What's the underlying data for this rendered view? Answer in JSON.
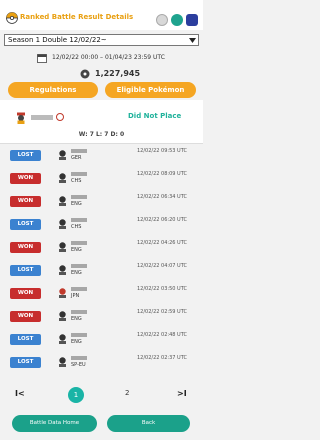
{
  "header": {
    "title": "Ranked Battle Result Details"
  },
  "season_select": {
    "selected": "Season 1 Double 12/02/22~"
  },
  "date_range": "12/02/22 00:00 – 01/04/23 23:59 UTC",
  "score": "1,227,945",
  "buttons": {
    "regulations": "Regulations",
    "eligible": "Eligible Pokémon"
  },
  "player": {
    "placement": "Did Not Place",
    "record": "W: 7 L: 7 D: 0"
  },
  "battles": [
    {
      "result": "LOST",
      "country": "GER",
      "time": "12/02/22 09:53 UTC"
    },
    {
      "result": "WON",
      "country": "CHS",
      "time": "12/02/22 08:09 UTC"
    },
    {
      "result": "WON",
      "country": "ENG",
      "time": "12/02/22 06:34 UTC"
    },
    {
      "result": "LOST",
      "country": "CHS",
      "time": "12/02/22 06:20 UTC"
    },
    {
      "result": "WON",
      "country": "ENG",
      "time": "12/02/22 04:26 UTC"
    },
    {
      "result": "LOST",
      "country": "ENG",
      "time": "12/02/22 04:07 UTC"
    },
    {
      "result": "WON",
      "country": "JPN",
      "time": "12/02/22 03:50 UTC"
    },
    {
      "result": "WON",
      "country": "ENG",
      "time": "12/02/22 02:59 UTC"
    },
    {
      "result": "LOST",
      "country": "ENG",
      "time": "12/02/22 02:48 UTC"
    },
    {
      "result": "LOST",
      "country": "SP-EU",
      "time": "12/02/22 02:37 UTC"
    }
  ],
  "pagination": {
    "first": "I<",
    "current": "1",
    "next": "2",
    "last": ">I"
  },
  "footer": {
    "home": "Battle Data Home",
    "back": "Back"
  },
  "colors": {
    "accent_orange": "#f5a623",
    "teal": "#1ab4a6",
    "lost": "#3b82d0",
    "won": "#c72d2d"
  }
}
